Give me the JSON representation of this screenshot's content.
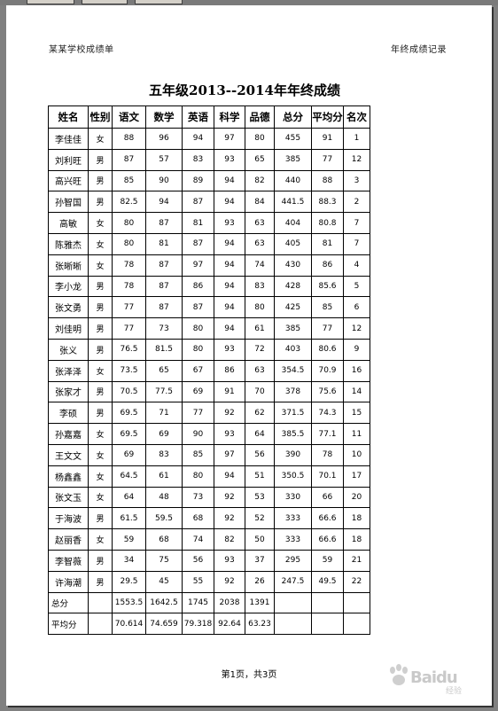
{
  "page_header": {
    "left": "某某学校成绩单",
    "right": "年终成绩记录"
  },
  "title": "五年级2013--2014年年终成绩",
  "table": {
    "columns": [
      "姓名",
      "性别",
      "语文",
      "数学",
      "英语",
      "科学",
      "品德",
      "总分",
      "平均分",
      "名次"
    ],
    "rows": [
      [
        "李佳佳",
        "女",
        "88",
        "96",
        "94",
        "97",
        "80",
        "455",
        "91",
        "1"
      ],
      [
        "刘利旺",
        "男",
        "87",
        "57",
        "83",
        "93",
        "65",
        "385",
        "77",
        "12"
      ],
      [
        "高兴旺",
        "男",
        "85",
        "90",
        "89",
        "94",
        "82",
        "440",
        "88",
        "3"
      ],
      [
        "孙智国",
        "男",
        "82.5",
        "94",
        "87",
        "94",
        "84",
        "441.5",
        "88.3",
        "2"
      ],
      [
        "高敏",
        "女",
        "80",
        "87",
        "81",
        "93",
        "63",
        "404",
        "80.8",
        "7"
      ],
      [
        "陈雅杰",
        "女",
        "80",
        "81",
        "87",
        "94",
        "63",
        "405",
        "81",
        "7"
      ],
      [
        "张晰晰",
        "女",
        "78",
        "87",
        "97",
        "94",
        "74",
        "430",
        "86",
        "4"
      ],
      [
        "李小龙",
        "男",
        "78",
        "87",
        "86",
        "94",
        "83",
        "428",
        "85.6",
        "5"
      ],
      [
        "张文勇",
        "男",
        "77",
        "87",
        "87",
        "94",
        "80",
        "425",
        "85",
        "6"
      ],
      [
        "刘佳明",
        "男",
        "77",
        "73",
        "80",
        "94",
        "61",
        "385",
        "77",
        "12"
      ],
      [
        "张义",
        "男",
        "76.5",
        "81.5",
        "80",
        "93",
        "72",
        "403",
        "80.6",
        "9"
      ],
      [
        "张泽泽",
        "女",
        "73.5",
        "65",
        "67",
        "86",
        "63",
        "354.5",
        "70.9",
        "16"
      ],
      [
        "张家才",
        "男",
        "70.5",
        "77.5",
        "69",
        "91",
        "70",
        "378",
        "75.6",
        "14"
      ],
      [
        "李硕",
        "男",
        "69.5",
        "71",
        "77",
        "92",
        "62",
        "371.5",
        "74.3",
        "15"
      ],
      [
        "孙嘉嘉",
        "女",
        "69.5",
        "69",
        "90",
        "93",
        "64",
        "385.5",
        "77.1",
        "11"
      ],
      [
        "王文文",
        "女",
        "69",
        "83",
        "85",
        "97",
        "56",
        "390",
        "78",
        "10"
      ],
      [
        "杨鑫鑫",
        "女",
        "64.5",
        "61",
        "80",
        "94",
        "51",
        "350.5",
        "70.1",
        "17"
      ],
      [
        "张文玉",
        "女",
        "64",
        "48",
        "73",
        "92",
        "53",
        "330",
        "66",
        "20"
      ],
      [
        "于海波",
        "男",
        "61.5",
        "59.5",
        "68",
        "92",
        "52",
        "333",
        "66.6",
        "18"
      ],
      [
        "赵丽香",
        "女",
        "59",
        "68",
        "74",
        "82",
        "50",
        "333",
        "66.6",
        "18"
      ],
      [
        "李智薇",
        "男",
        "34",
        "75",
        "56",
        "93",
        "37",
        "295",
        "59",
        "21"
      ],
      [
        "许海潮",
        "男",
        "29.5",
        "45",
        "55",
        "92",
        "26",
        "247.5",
        "49.5",
        "22"
      ]
    ],
    "totals": {
      "label": "总分",
      "values": [
        "1553.5",
        "1642.5",
        "1745",
        "2038",
        "1391"
      ]
    },
    "averages": {
      "label": "平均分",
      "values": [
        "70.614",
        "74.659",
        "79.318",
        "92.64",
        "63.23"
      ]
    }
  },
  "footer": "第1页，共3页",
  "watermark": {
    "text": "Baidu",
    "sub": "经验"
  }
}
